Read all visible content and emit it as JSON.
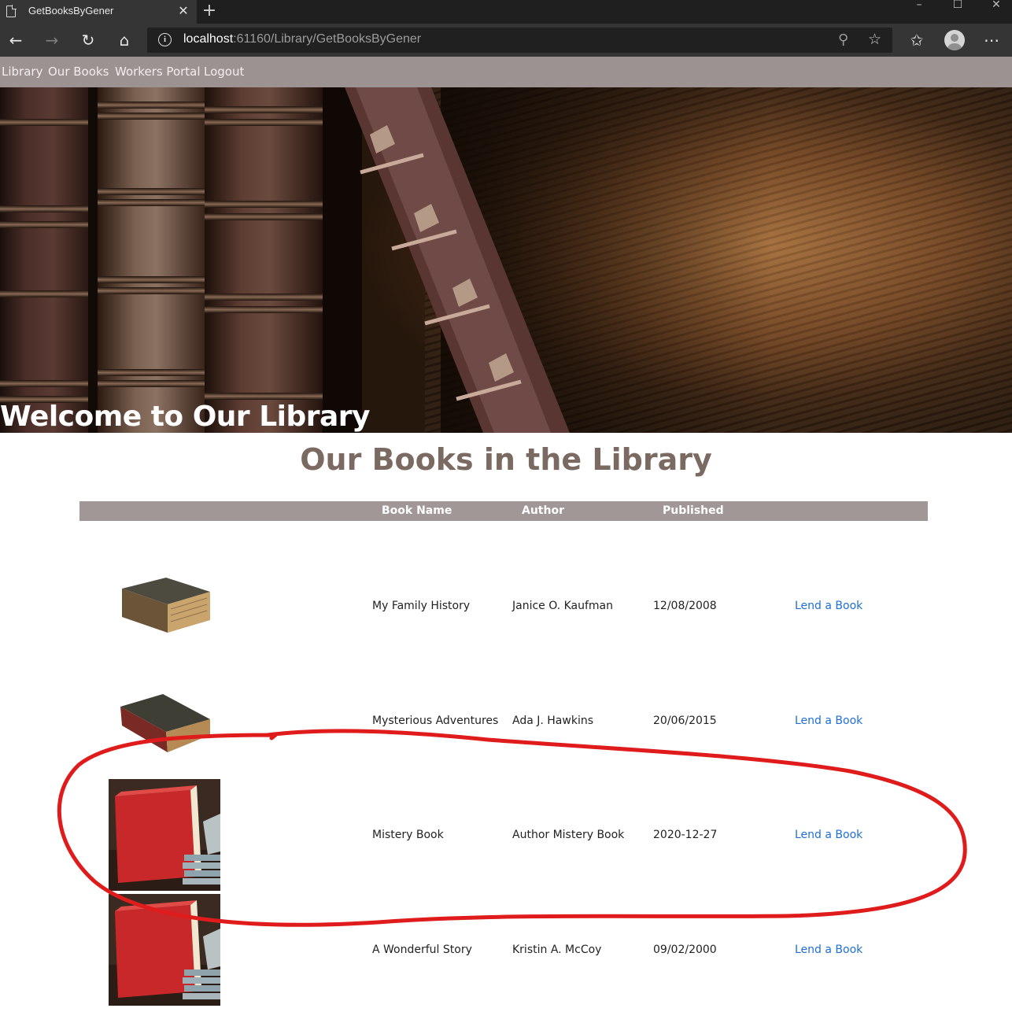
{
  "browser": {
    "tab_title": "GetBooksByGener",
    "url_host": "localhost",
    "url_rest": ":61160/Library/GetBooksByGener"
  },
  "nav": {
    "items": [
      "Library",
      "Our Books",
      "Workers Portal",
      "Logout"
    ]
  },
  "hero": {
    "title": "Welcome to Our Library"
  },
  "main": {
    "heading": "Our Books in the Library",
    "columns": [
      "Book Name",
      "Author",
      "Published"
    ],
    "rows": [
      {
        "name": "My Family History",
        "author": "Janice O. Kaufman",
        "published": "12/08/2008",
        "action": "Lend a Book",
        "thumb": "old-book"
      },
      {
        "name": "Mysterious Adventures",
        "author": "Ada J. Hawkins",
        "published": "20/06/2015",
        "action": "Lend a Book",
        "thumb": "old-book-red"
      },
      {
        "name": "Mistery Book",
        "author": "Author Mistery Book",
        "published": "2020-12-27",
        "action": "Lend a Book",
        "thumb": "red-book-photo"
      },
      {
        "name": "A Wonderful Story",
        "author": "Kristin A. McCoy",
        "published": "09/02/2000",
        "action": "Lend a Book",
        "thumb": "red-book-photo"
      }
    ]
  },
  "colors": {
    "nav_bg": "#9c9291",
    "table_header_bg": "#a29797",
    "heading": "#7a6a62",
    "link": "#1f6fd6",
    "annotation": "#e01b1b"
  },
  "icons": [
    "page-icon",
    "close-icon",
    "plus-icon",
    "back-icon",
    "forward-icon",
    "refresh-icon",
    "home-icon",
    "info-icon",
    "zoom-icon",
    "star-icon",
    "favorites-icon",
    "profile-icon",
    "more-icon"
  ]
}
